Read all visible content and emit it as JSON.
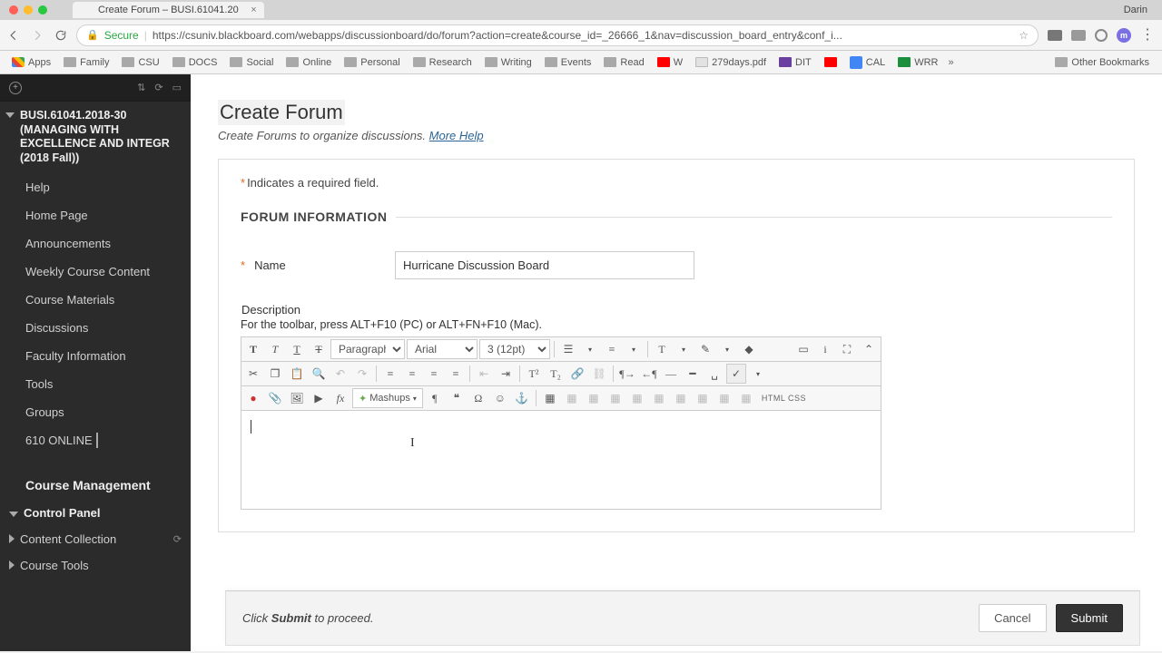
{
  "browser": {
    "tab_title": "Create Forum – BUSI.61041.20",
    "user": "Darin",
    "secure_label": "Secure",
    "url": "https://csuniv.blackboard.com/webapps/discussionboard/do/forum?action=create&course_id=_26666_1&nav=discussion_board_entry&conf_i...",
    "m_badge": "m",
    "bookmarks": [
      "Apps",
      "Family",
      "CSU",
      "DOCS",
      "Social",
      "Online",
      "Personal",
      "Research",
      "Writing",
      "Events",
      "Read",
      "W",
      "279days.pdf",
      "DIT",
      "CAL",
      "WRR"
    ],
    "other_bookmarks": "Other Bookmarks"
  },
  "sidebar": {
    "course_title": "BUSI.61041.2018-30 (MANAGING WITH EXCELLENCE AND INTEGR (2018 Fall))",
    "links": [
      "Help",
      "Home Page",
      "Announcements",
      "Weekly Course Content",
      "Course Materials",
      "Discussions",
      "Faculty Information",
      "Tools",
      "Groups"
    ],
    "online_label": "610 ONLINE",
    "mgmt_heading": "Course Management",
    "control_panel": "Control Panel",
    "content_collection": "Content Collection",
    "course_tools": "Course Tools"
  },
  "page": {
    "title": "Create Forum",
    "subtitle": "Create Forums to organize discussions.",
    "more_help": "More Help",
    "required_hint": "Indicates a required field.",
    "section_heading": "FORUM INFORMATION",
    "name_label": "Name",
    "name_value": "Hurricane Discussion Board",
    "desc_label": "Description",
    "toolbar_hint": "For the toolbar, press ALT+F10 (PC) or ALT+FN+F10 (Mac)."
  },
  "editor": {
    "format": "Paragraph",
    "font": "Arial",
    "size": "3 (12pt)",
    "mashups": "Mashups",
    "htmlcss": "HTML CSS"
  },
  "footer": {
    "text_prefix": "Click ",
    "text_bold": "Submit",
    "text_suffix": " to proceed.",
    "cancel": "Cancel",
    "submit": "Submit"
  }
}
